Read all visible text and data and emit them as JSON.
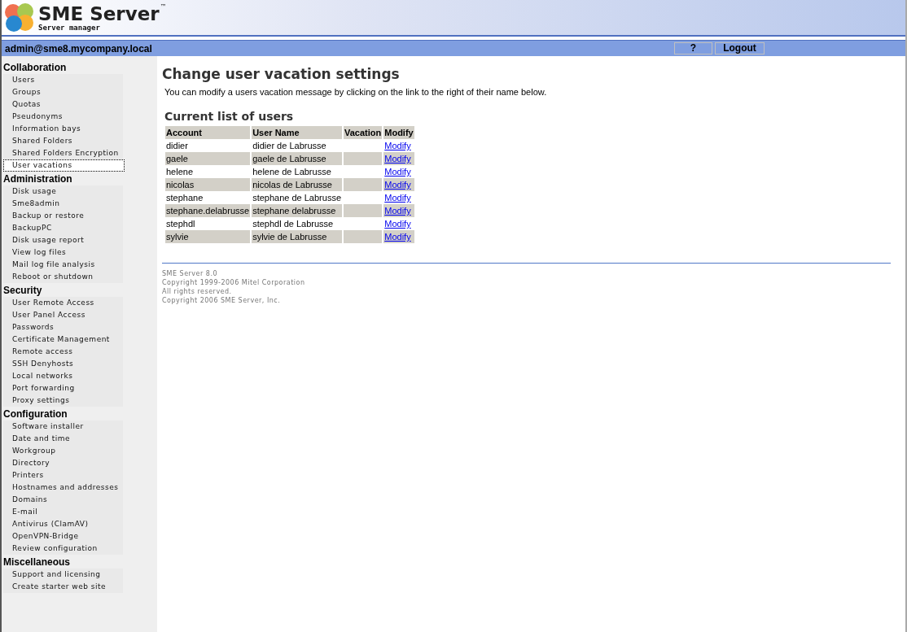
{
  "header": {
    "logo_title": "SME Server",
    "logo_mark": "™",
    "logo_subtitle": "Server manager"
  },
  "top_bar": {
    "user": "admin@sme8.mycompany.local",
    "buttons": [
      "?",
      "Logout"
    ]
  },
  "sidebar": {
    "sections": [
      {
        "title": "Collaboration",
        "items": [
          {
            "label": "Users",
            "selected": false
          },
          {
            "label": "Groups",
            "selected": false
          },
          {
            "label": "Quotas",
            "selected": false
          },
          {
            "label": "Pseudonyms",
            "selected": false
          },
          {
            "label": "Information bays",
            "selected": false
          },
          {
            "label": "Shared Folders",
            "selected": false
          },
          {
            "label": "Shared Folders Encryption",
            "selected": false
          },
          {
            "label": "User vacations",
            "selected": true
          }
        ]
      },
      {
        "title": "Administration",
        "items": [
          {
            "label": "Disk usage",
            "selected": false
          },
          {
            "label": "Sme8admin",
            "selected": false
          },
          {
            "label": "Backup or restore",
            "selected": false
          },
          {
            "label": "BackupPC",
            "selected": false
          },
          {
            "label": "Disk usage report",
            "selected": false
          },
          {
            "label": "View log files",
            "selected": false
          },
          {
            "label": "Mail log file analysis",
            "selected": false
          },
          {
            "label": "Reboot or shutdown",
            "selected": false
          }
        ]
      },
      {
        "title": "Security",
        "items": [
          {
            "label": "User Remote Access",
            "selected": false
          },
          {
            "label": "User Panel Access",
            "selected": false
          },
          {
            "label": "Passwords",
            "selected": false
          },
          {
            "label": "Certificate Management",
            "selected": false
          },
          {
            "label": "Remote access",
            "selected": false
          },
          {
            "label": "SSH Denyhosts",
            "selected": false
          },
          {
            "label": "Local networks",
            "selected": false
          },
          {
            "label": "Port forwarding",
            "selected": false
          },
          {
            "label": "Proxy settings",
            "selected": false
          }
        ]
      },
      {
        "title": "Configuration",
        "items": [
          {
            "label": "Software installer",
            "selected": false
          },
          {
            "label": "Date and time",
            "selected": false
          },
          {
            "label": "Workgroup",
            "selected": false
          },
          {
            "label": "Directory",
            "selected": false
          },
          {
            "label": "Printers",
            "selected": false
          },
          {
            "label": "Hostnames and addresses",
            "selected": false
          },
          {
            "label": "Domains",
            "selected": false
          },
          {
            "label": "E-mail",
            "selected": false
          },
          {
            "label": "Antivirus (ClamAV)",
            "selected": false
          },
          {
            "label": "OpenVPN-Bridge",
            "selected": false
          },
          {
            "label": "Review configuration",
            "selected": false
          }
        ]
      },
      {
        "title": "Miscellaneous",
        "items": [
          {
            "label": "Support and licensing",
            "selected": false
          },
          {
            "label": "Create starter web site",
            "selected": false
          }
        ]
      }
    ]
  },
  "main": {
    "title": "Change user vacation settings",
    "description": "You can modify a users vacation message by clicking on the link to the right of their name below.",
    "list_title": "Current list of users",
    "table": {
      "columns": [
        "Account",
        "User Name",
        "Vacation",
        "Modify"
      ],
      "rows": [
        {
          "account": "didier",
          "user_name": "didier de Labrusse",
          "modify": "Modify"
        },
        {
          "account": "gaele",
          "user_name": "gaele de Labrusse",
          "modify": "Modify"
        },
        {
          "account": "helene",
          "user_name": "helene de Labrusse",
          "modify": "Modify"
        },
        {
          "account": "nicolas",
          "user_name": "nicolas de Labrusse",
          "modify": "Modify"
        },
        {
          "account": "stephane",
          "user_name": "stephane de Labrusse",
          "modify": "Modify"
        },
        {
          "account": "stephane.delabrusse",
          "user_name": "stephane delabrusse",
          "modify": "Modify"
        },
        {
          "account": "stephdl",
          "user_name": "stephdl de Labrusse",
          "modify": "Modify"
        },
        {
          "account": "sylvie",
          "user_name": "sylvie de Labrusse",
          "modify": "Modify"
        }
      ]
    },
    "footer": [
      "SME Server 8.0",
      "Copyright 1999-2006 Mitel Corporation",
      "All rights reserved.",
      "Copyright 2006 SME Server, Inc."
    ]
  }
}
